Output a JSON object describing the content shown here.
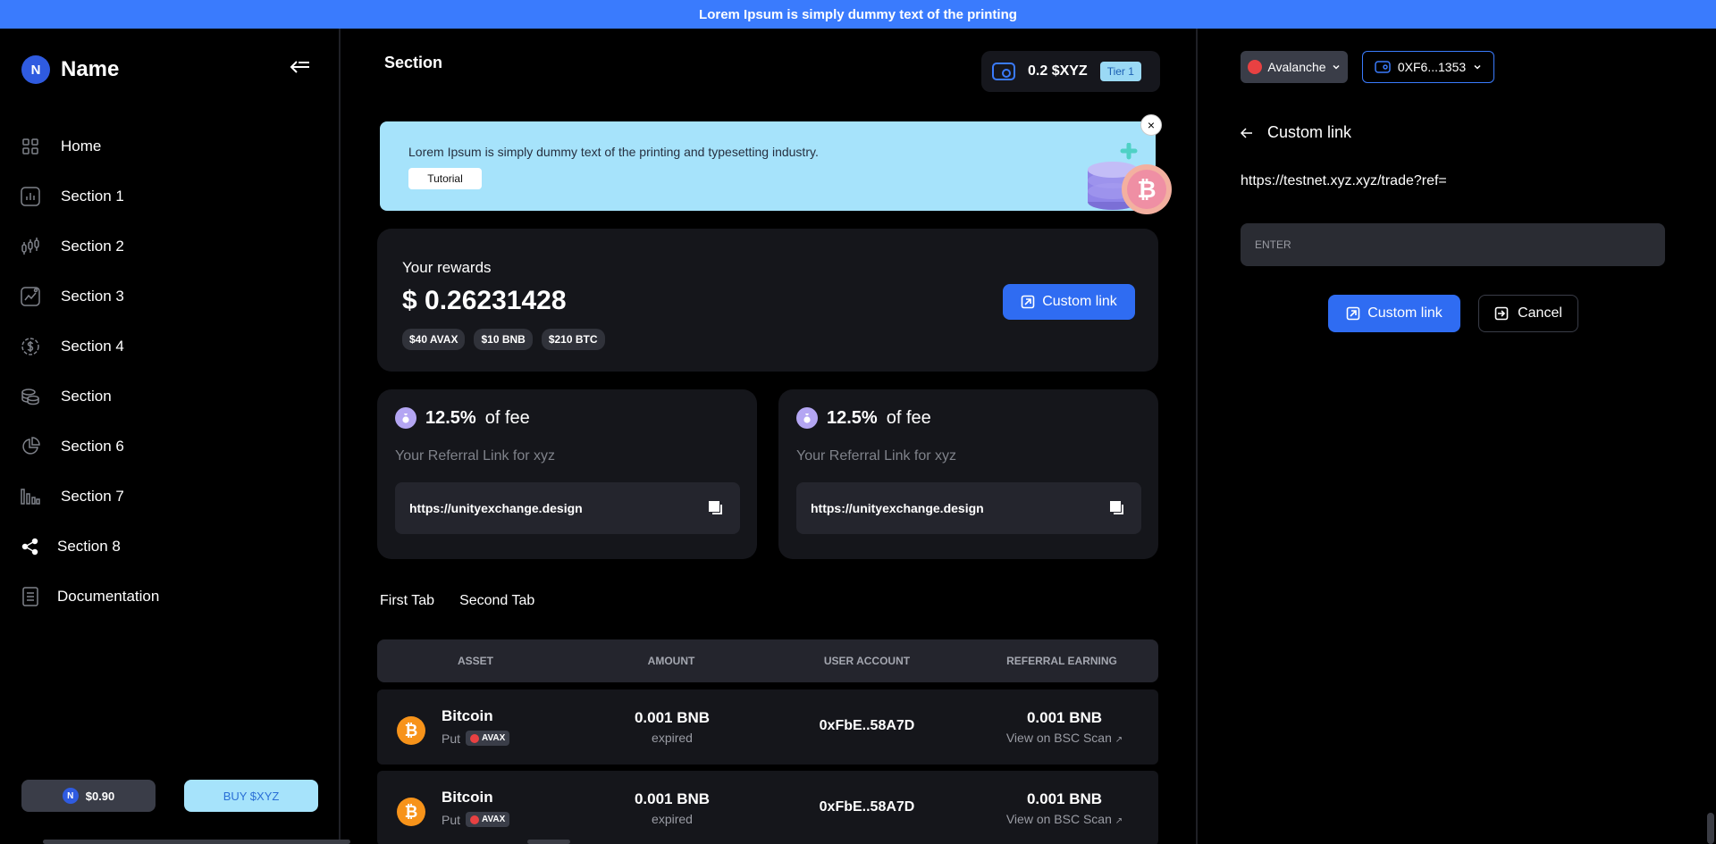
{
  "topbar": {
    "text": "Lorem Ipsum is simply dummy text of the printing"
  },
  "sidebar": {
    "brand_letter": "N",
    "brand_name": "Name",
    "items": [
      {
        "label": "Home",
        "icon": "grid-icon"
      },
      {
        "label": "Section 1",
        "icon": "bar-chart-icon"
      },
      {
        "label": "Section 2",
        "icon": "candles-icon"
      },
      {
        "label": "Section 3",
        "icon": "trend-icon"
      },
      {
        "label": "Section 4",
        "icon": "dollar-icon"
      },
      {
        "label": "Section",
        "icon": "coins-icon"
      },
      {
        "label": "Section 6",
        "icon": "pie-icon"
      },
      {
        "label": "Section 7",
        "icon": "bars-icon"
      },
      {
        "label": "Section 8",
        "icon": "share-icon"
      },
      {
        "label": "Documentation",
        "icon": "document-icon"
      }
    ],
    "price_letter": "N",
    "price": "$0.90",
    "buy_label": "BUY $XYZ"
  },
  "main": {
    "title": "Section",
    "wallet_amount": "0.2 $XYZ",
    "tier": "Tier 1",
    "banner": {
      "text": "Lorem Ipsum is simply dummy text of the printing and typesetting industry.",
      "tutorial": "Tutorial",
      "close": "×"
    },
    "rewards": {
      "label": "Your rewards",
      "value": "$ 0.26231428",
      "tokens": [
        "$40 AVAX",
        "$10 BNB",
        "$210 BTC"
      ],
      "button": "Custom link"
    },
    "fee_cards": [
      {
        "pct": "12.5%",
        "suffix": "of fee",
        "sub": "Your Referral Link for xyz",
        "link": "https://unityexchange.design"
      },
      {
        "pct": "12.5%",
        "suffix": "of fee",
        "sub": "Your Referral Link for xyz",
        "link": "https://unityexchange.design"
      }
    ],
    "tabs": [
      "First Tab",
      "Second Tab"
    ],
    "table": {
      "headers": [
        "ASSET",
        "AMOUNT",
        "USER ACCOUNT",
        "REFERRAL EARNING"
      ],
      "rows": [
        {
          "asset": "Bitcoin",
          "type": "Put",
          "chain": "AVAX",
          "amount": "0.001 BNB",
          "status": "expired",
          "account": "0xFbE..58A7D",
          "earning": "0.001 BNB",
          "link": "View on BSC Scan"
        },
        {
          "asset": "Bitcoin",
          "type": "Put",
          "chain": "AVAX",
          "amount": "0.001 BNB",
          "status": "expired",
          "account": "0xFbE..58A7D",
          "earning": "0.001 BNB",
          "link": "View on BSC Scan"
        }
      ]
    }
  },
  "panel": {
    "network": "Avalanche",
    "address": "0XF6...1353",
    "back_label": "Custom link",
    "url": "https://testnet.xyz.xyz/trade?ref=",
    "input_placeholder": "ENTER",
    "submit": "Custom link",
    "cancel": "Cancel"
  },
  "colors": {
    "accent": "#3a7bfd",
    "banner": "#a6e3fb",
    "card": "#15161b",
    "bitcoin": "#f7931a",
    "avax": "#e84142"
  }
}
